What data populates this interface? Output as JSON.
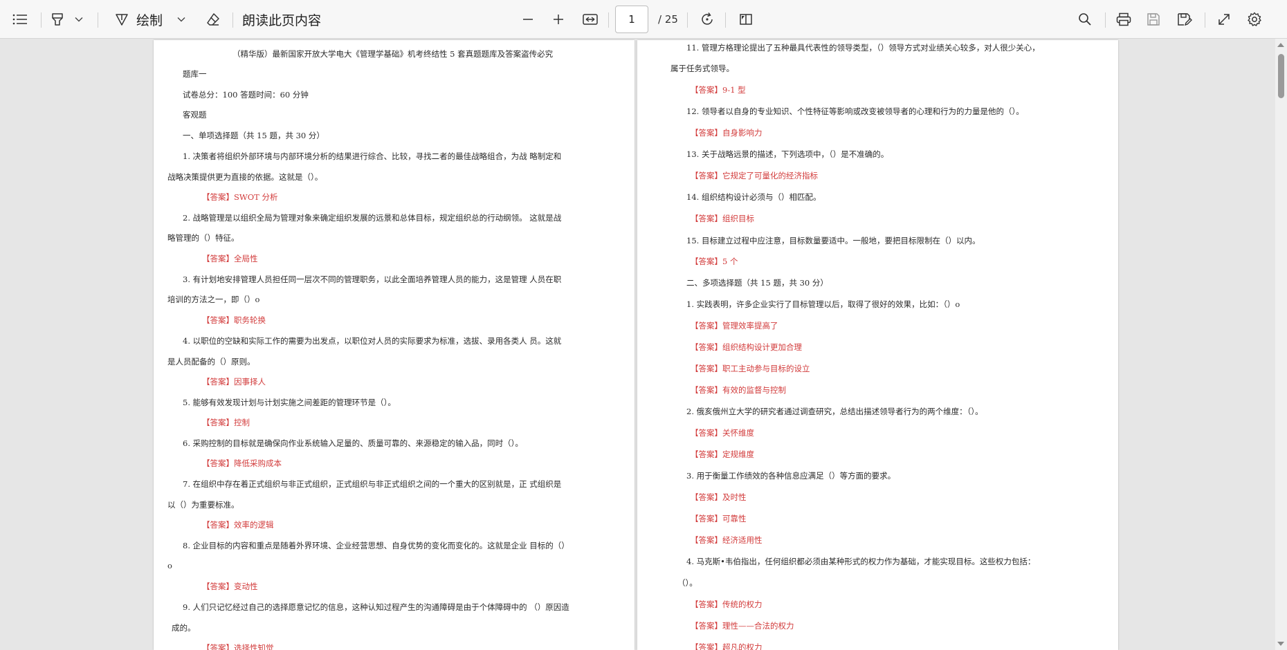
{
  "toolbar": {
    "draw_label": "绘制",
    "read_aloud_label": "朗读此页内容",
    "page_current": "1",
    "page_total": "/ 25",
    "icons": [
      "contents-icon",
      "highlighter-icon",
      "pen-icon",
      "eraser-icon",
      "zoom-out-icon",
      "zoom-in-icon",
      "fit-width-icon",
      "rotate-icon",
      "page-view-icon",
      "search-icon",
      "print-icon",
      "save-icon",
      "save-as-icon",
      "fullscreen-icon",
      "settings-icon"
    ]
  },
  "left_page": {
    "lines": [
      {
        "text": "（精华版）最新国家开放大学电大《管理学基础》机考终结性 5 套真题题库及答案盗传必究",
        "ans": false
      },
      {
        "text": "题库一",
        "ans": false
      },
      {
        "text": "试卷总分：100 答题时间：60 分钟",
        "ans": false
      },
      {
        "text": "客观题",
        "ans": false
      },
      {
        "text": "一、单项选择题（共 15 题，共 30 分）",
        "ans": false
      },
      {
        "text": "1.  决策者将组织外部环境与内部环境分析的结果进行综合、比较，寻找二者的最佳战略组合，为战  略制定和",
        "ans": false
      },
      {
        "text": "战略决策提供更为直接的依据。这就是（）。",
        "ans": false
      },
      {
        "text": "【答案】SWOT 分析",
        "ans": true
      },
      {
        "text": "2.  战略管理是以组织全局为管理对象来确定组织发展的远景和总体目标，规定组织总的行动纲领。 这就是战",
        "ans": false
      },
      {
        "text": "略管理的（）特征。",
        "ans": false
      },
      {
        "text": "【答案】全局性",
        "ans": true
      },
      {
        "text": "3.  有计划地安排管理人员担任同一层次不同的管理职务，以此全面培养管理人员的能力，这是管理  人员在职",
        "ans": false
      },
      {
        "text": "培训的方法之一，即（）o",
        "ans": false
      },
      {
        "text": "【答案】职务轮换",
        "ans": true
      },
      {
        "text": "4.  以职位的空缺和实际工作的需要为出发点，以职位对人员的实际要求为标准，选拔、录用各类人  员。这就",
        "ans": false
      },
      {
        "text": "是人员配备的（）原则。",
        "ans": false
      },
      {
        "text": "【答案】因事择人",
        "ans": true
      },
      {
        "text": "5.  能够有效发现计划与计划实施之间差距的管理环节是（）。",
        "ans": false
      },
      {
        "text": "【答案】控制",
        "ans": true
      },
      {
        "text": "6.  采购控制的目标就是确保向作业系统输入足量的、质量可靠的、来源稳定的输入品，同时（）。",
        "ans": false
      },
      {
        "text": "【答案】降低采购成本",
        "ans": true
      },
      {
        "text": "7.  在组织中存在着正式组织与非正式组织，正式组织与非正式组织之间的一个重大的区别就是，正  式组织是",
        "ans": false
      },
      {
        "text": "以（）为重要标准。",
        "ans": false
      },
      {
        "text": "【答案】效率的逻辑",
        "ans": true
      },
      {
        "text": "8.  企业目标的内容和重点是随着外界环境、企业经营思想、自身优势的变化而变化的。这就是企业  目标的（）",
        "ans": false
      },
      {
        "text": "o",
        "ans": false
      },
      {
        "text": "【答案】变动性",
        "ans": true
      },
      {
        "text": "9.  人们只记忆经过自己的选择愿意记忆的信息，这种认知过程产生的沟通障碍是由于个体障碍中的 （）原因造",
        "ans": false
      },
      {
        "text": "成的。",
        "ans": false
      },
      {
        "text": "【答案】选择性知觉",
        "ans": true
      }
    ]
  },
  "right_page": {
    "lines": [
      {
        "text": "11. 管理方格理论提出了五种最具代表性的领导类型，（）领导方式对业绩关心较多，对人很少关心，",
        "ans": false
      },
      {
        "text": "属于任务式领导。",
        "ans": false
      },
      {
        "text": "【答案】9-1 型",
        "ans": true
      },
      {
        "text": "12.  领导者以自身的专业知识、个性特征等影响或改变被领导者的心理和行为的力量是他的（）。",
        "ans": false
      },
      {
        "text": "【答案】自身影响力",
        "ans": true
      },
      {
        "text": "13.  关于战略远景的描述，下列选项中，（）是不准确的。",
        "ans": false
      },
      {
        "text": "【答案】它规定了可量化的经济指标",
        "ans": true
      },
      {
        "text": "14.  组织结构设计必须与（）相匹配。",
        "ans": false
      },
      {
        "text": "【答案】组织目标",
        "ans": true
      },
      {
        "text": "15.  目标建立过程中应注意，目标数量要适中。一般地，要把目标限制在（）以内。",
        "ans": false
      },
      {
        "text": "【答案】5 个",
        "ans": true
      },
      {
        "text": "二、多项选择题（共 15 题，共 30 分）",
        "ans": false
      },
      {
        "text": "1.  实践表明，许多企业实行了目标管理以后，取得了很好的效果，比如：（）o",
        "ans": false
      },
      {
        "text": "【答案】管理效率提高了",
        "ans": true
      },
      {
        "text": "【答案】组织结构设计更加合理",
        "ans": true
      },
      {
        "text": "【答案】职工主动参与目标的设立",
        "ans": true
      },
      {
        "text": "【答案】有效的监督与控制",
        "ans": true
      },
      {
        "text": "2.  俄亥俄州立大学的研究者通过调查研究，总结出描述领导者行为的两个维度：（）。",
        "ans": false
      },
      {
        "text": "【答案】关怀维度",
        "ans": true
      },
      {
        "text": "【答案】定规维度",
        "ans": true
      },
      {
        "text": "3.  用于衡量工作绩效的各种信息应满足（）等方面的要求。",
        "ans": false
      },
      {
        "text": "【答案】及时性",
        "ans": true
      },
      {
        "text": "【答案】可靠性",
        "ans": true
      },
      {
        "text": "【答案】经济适用性",
        "ans": true
      },
      {
        "text": "4.  马克斯•韦伯指出，任何组织都必须由某种形式的权力作为基础，才能实现目标。这些权力包括：",
        "ans": false
      },
      {
        "text": "（）。",
        "ans": false
      },
      {
        "text": "【答案】传统的权力",
        "ans": true
      },
      {
        "text": "【答案】理性——合法的权力",
        "ans": true
      },
      {
        "text": "【答案】超凡的权力",
        "ans": true
      }
    ]
  },
  "colors": {
    "answer": "#d23b3b",
    "toolbar_bg": "#f7f7f7",
    "canvas_bg": "#e6e6e6"
  }
}
